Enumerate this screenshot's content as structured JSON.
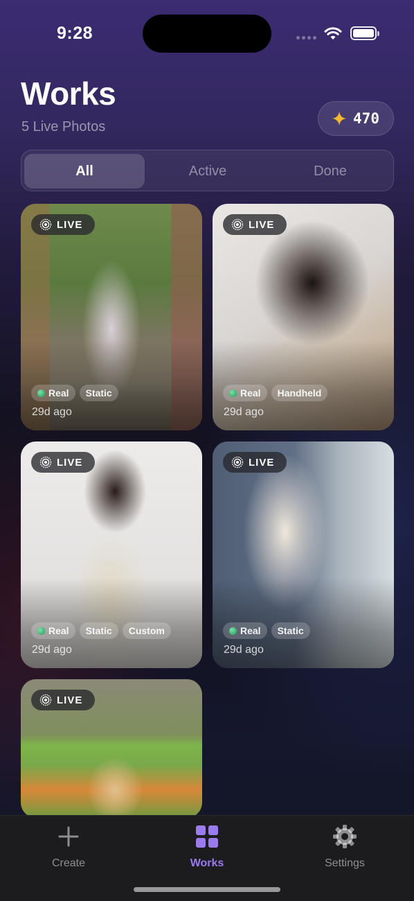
{
  "status_bar": {
    "time": "9:28"
  },
  "header": {
    "title": "Works",
    "subtitle": "5 Live Photos",
    "credits": "470"
  },
  "filters": {
    "tabs": [
      {
        "label": "All",
        "selected": true
      },
      {
        "label": "Active",
        "selected": false
      },
      {
        "label": "Done",
        "selected": false
      }
    ]
  },
  "works": [
    {
      "badge": "LIVE",
      "tags": [
        "Real",
        "Static"
      ],
      "age": "29d ago",
      "subject": "woman-hiking-stone-steps"
    },
    {
      "badge": "LIVE",
      "tags": [
        "Real",
        "Handheld"
      ],
      "age": "29d ago",
      "subject": "woman-resting-on-desk"
    },
    {
      "badge": "LIVE",
      "tags": [
        "Real",
        "Static",
        "Custom"
      ],
      "age": "29d ago",
      "subject": "woman-floral-dress"
    },
    {
      "badge": "LIVE",
      "tags": [
        "Real",
        "Static"
      ],
      "age": "29d ago",
      "subject": "mirror-selfie-office"
    },
    {
      "badge": "LIVE",
      "tags": [],
      "age": "",
      "subject": "puppy-in-flower-field"
    }
  ],
  "tab_bar": {
    "items": [
      {
        "label": "Create",
        "icon": "plus-icon",
        "selected": false
      },
      {
        "label": "Works",
        "icon": "grid-icon",
        "selected": true
      },
      {
        "label": "Settings",
        "icon": "gear-icon",
        "selected": false
      }
    ]
  },
  "colors": {
    "accent": "#9a7bf0",
    "star": "#f5b82e",
    "real_dot": "#2fbf6e",
    "tab_bar_bg": "#1c1c1f"
  }
}
